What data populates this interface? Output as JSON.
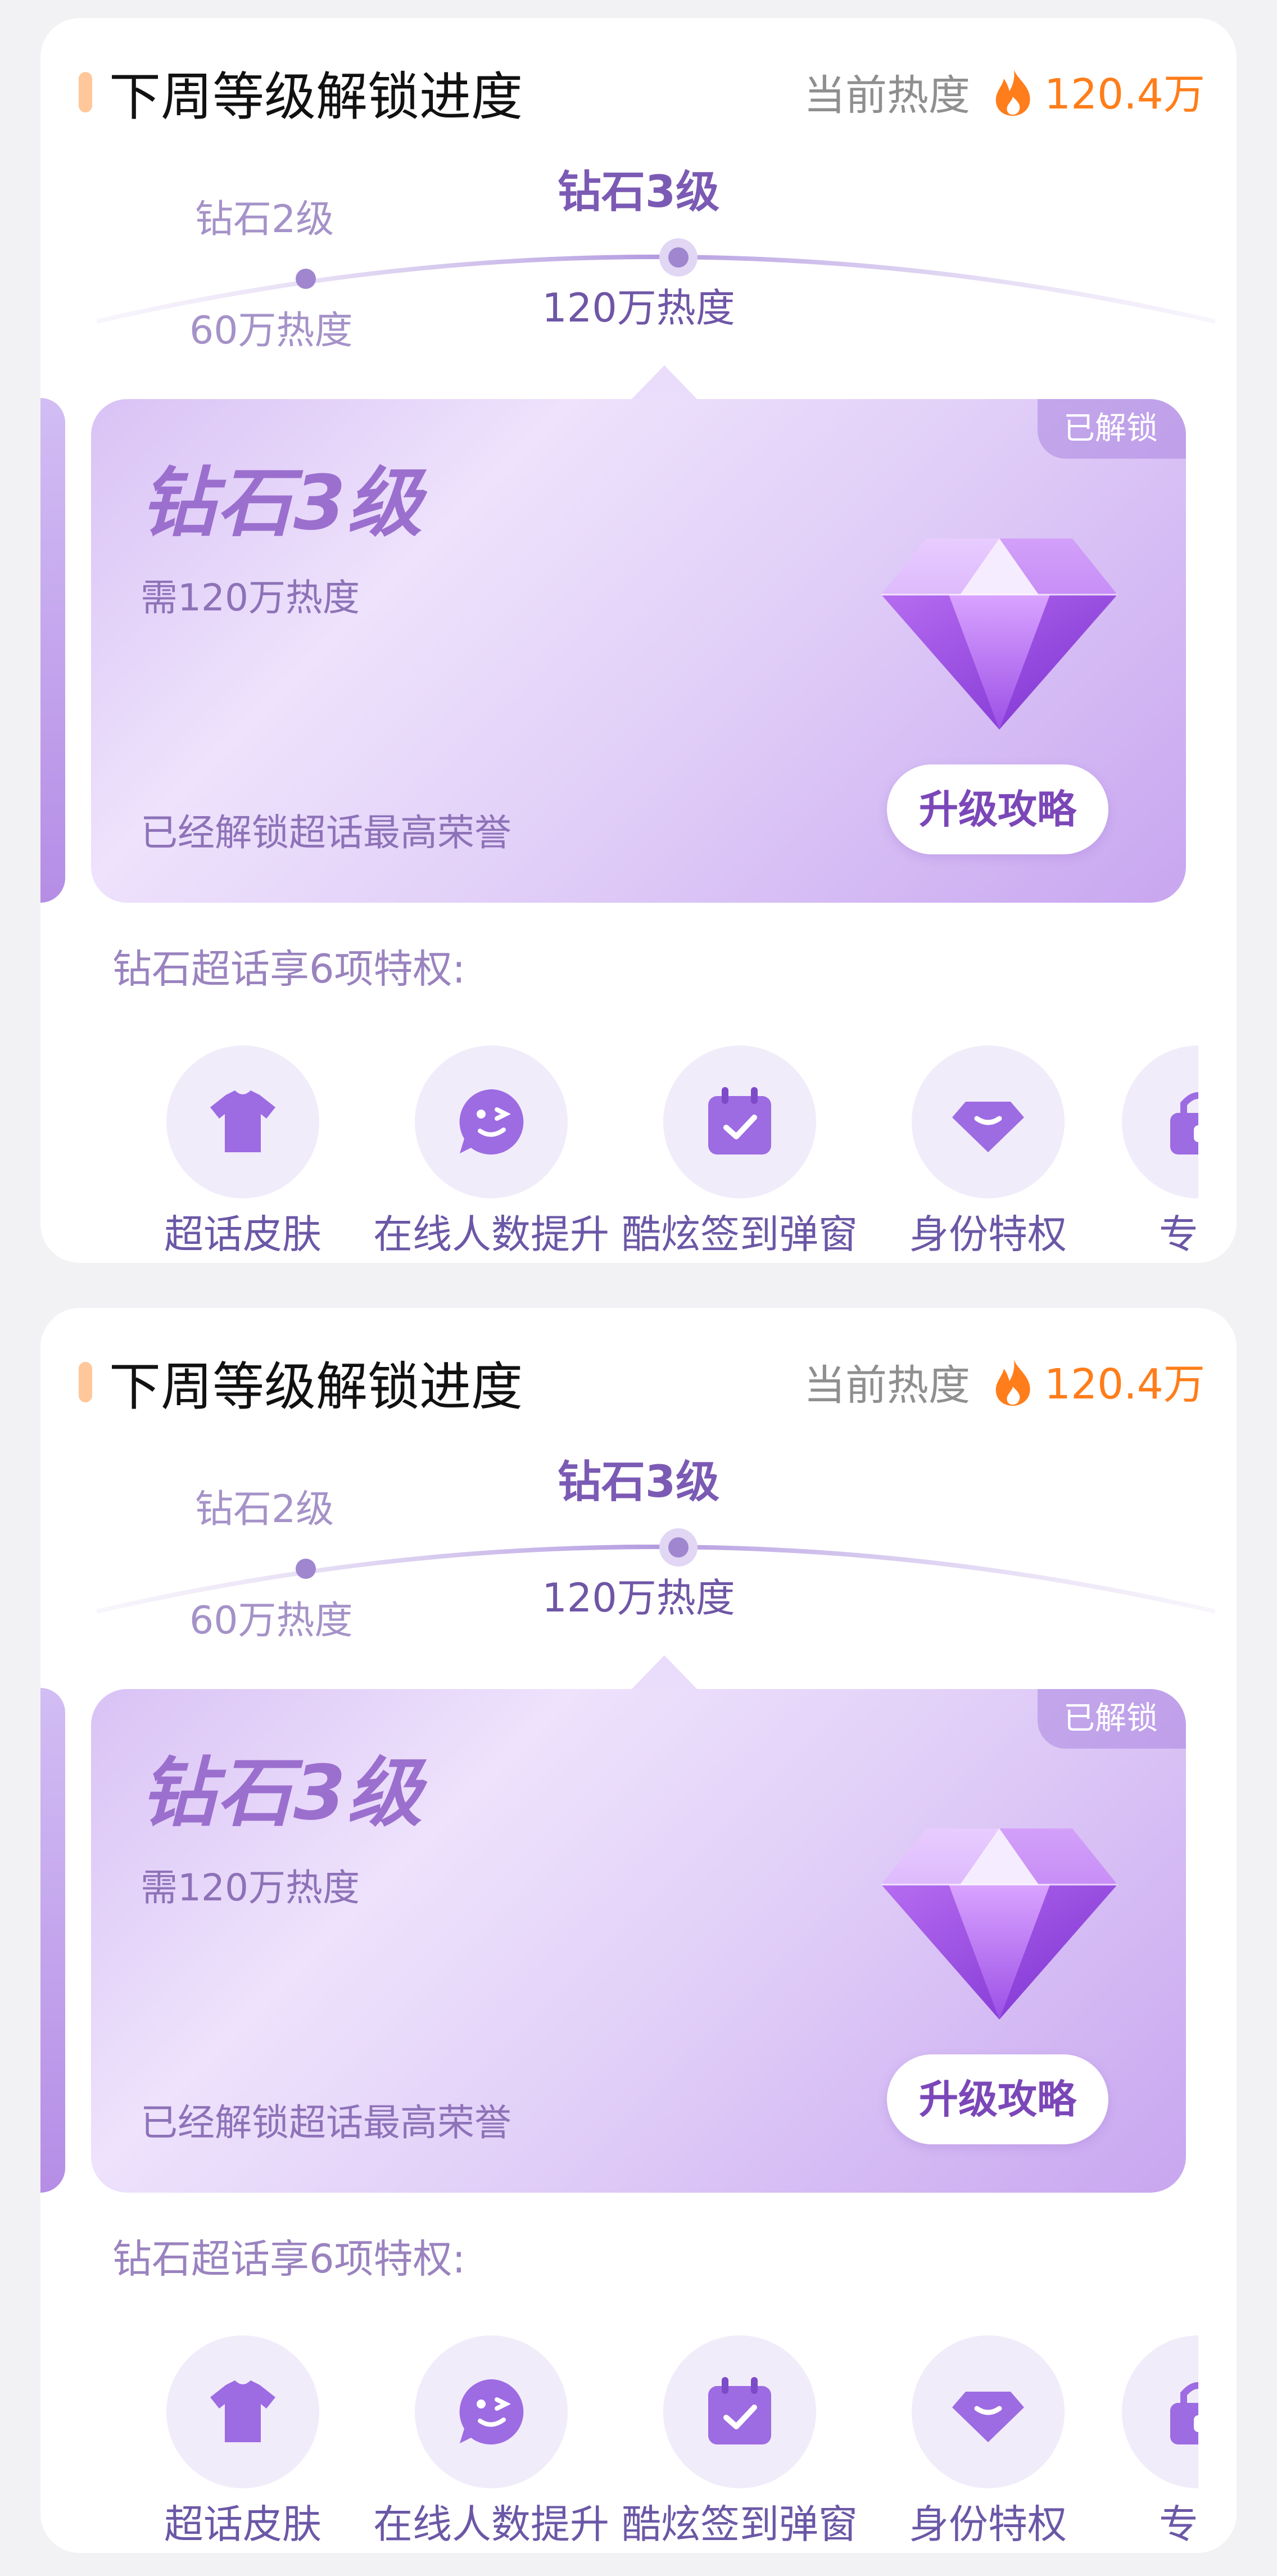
{
  "cards": [
    {
      "header": {
        "title": "下周等级解锁进度",
        "heat_label": "当前热度",
        "heat_value": "120.4万",
        "flame_icon": "flame-icon"
      },
      "levels": {
        "prev_name": "钻石2级",
        "prev_req": "60万热度",
        "current_name": "钻石3级",
        "current_req": "120万热度"
      },
      "level_card": {
        "tag": "已解锁",
        "title": "钻石3级",
        "requirement": "需120万热度",
        "honor": "已经解锁超话最高荣誉",
        "button": "升级攻略",
        "gem_icon": "diamond-icon"
      },
      "privileges": {
        "title": "钻石超话享6项特权:",
        "items": [
          {
            "label": "超话皮肤",
            "icon": "tshirt-icon"
          },
          {
            "label": "在线人数提升",
            "icon": "chat-smile-icon"
          },
          {
            "label": "酷炫签到弹窗",
            "icon": "calendar-check-icon"
          },
          {
            "label": "身份特权",
            "icon": "diamond-badge-icon"
          },
          {
            "label": "专属",
            "icon": "exclusive-icon"
          }
        ]
      }
    },
    {
      "header": {
        "title": "下周等级解锁进度",
        "heat_label": "当前热度",
        "heat_value": "120.4万",
        "flame_icon": "flame-icon"
      },
      "levels": {
        "prev_name": "钻石2级",
        "prev_req": "60万热度",
        "current_name": "钻石3级",
        "current_req": "120万热度"
      },
      "level_card": {
        "tag": "已解锁",
        "title": "钻石3级",
        "requirement": "需120万热度",
        "honor": "已经解锁超话最高荣誉",
        "button": "升级攻略",
        "gem_icon": "diamond-icon"
      },
      "privileges": {
        "title": "钻石超话享6项特权:",
        "items": [
          {
            "label": "超话皮肤",
            "icon": "tshirt-icon"
          },
          {
            "label": "在线人数提升",
            "icon": "chat-smile-icon"
          },
          {
            "label": "酷炫签到弹窗",
            "icon": "calendar-check-icon"
          },
          {
            "label": "身份特权",
            "icon": "diamond-badge-icon"
          },
          {
            "label": "专属",
            "icon": "exclusive-icon"
          }
        ]
      }
    }
  ],
  "colors": {
    "accent_orange": "#ff7d1a",
    "purple": "#7b5ab4",
    "background": "#f2f2f4"
  }
}
